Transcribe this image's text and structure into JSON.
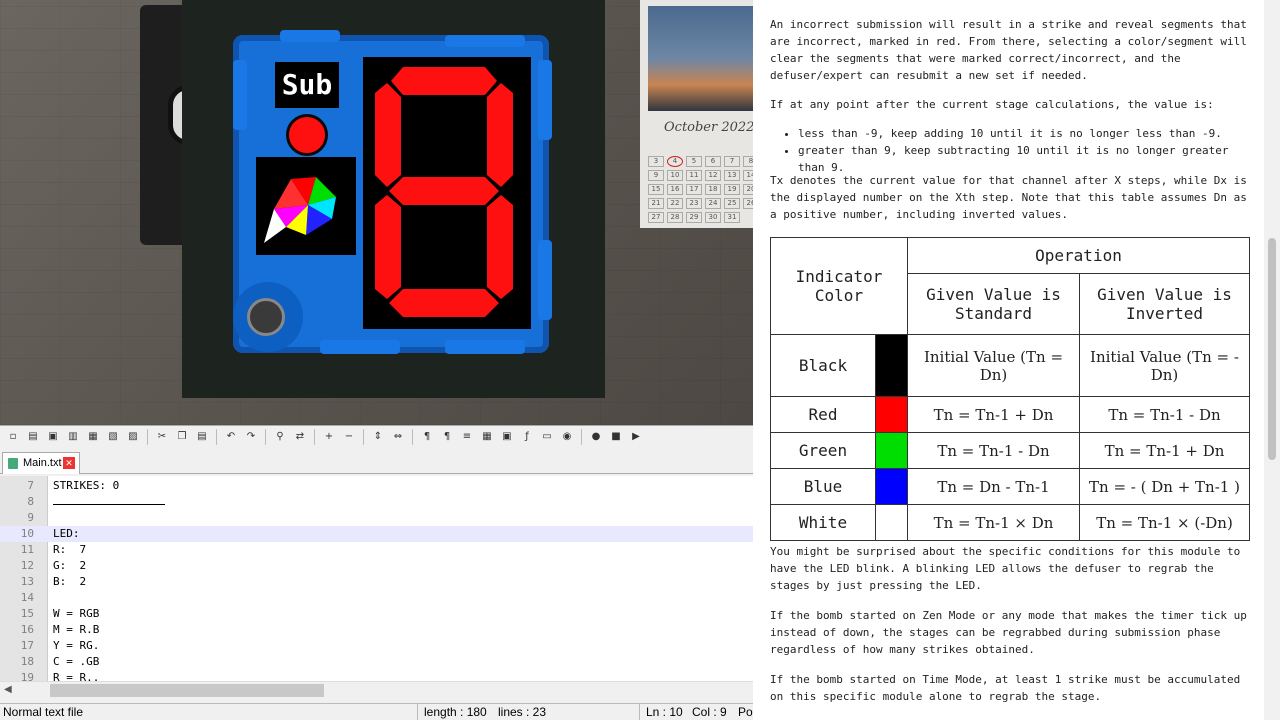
{
  "game": {
    "submit_label": "Sub",
    "led_color": "#ff1010",
    "display_color": "#ff1010",
    "calendar_month": "October 2022",
    "calendar_days": [
      "3",
      "4",
      "5",
      "6",
      "7",
      "8",
      "9",
      "10",
      "11",
      "12",
      "13",
      "14",
      "15",
      "16",
      "17",
      "18",
      "19",
      "20",
      "21",
      "22",
      "23",
      "24",
      "25",
      "26",
      "27",
      "28",
      "29",
      "30",
      "31"
    ]
  },
  "notepad": {
    "toolbar_icons": [
      "new-icon",
      "open-icon",
      "save-icon",
      "save-all-icon",
      "close-icon",
      "close-all-icon",
      "print-icon",
      "cut-icon",
      "copy-icon",
      "paste-icon",
      "undo-icon",
      "redo-icon",
      "find-icon",
      "replace-icon",
      "zoom-in-icon",
      "zoom-out-icon",
      "sync-v-icon",
      "sync-h-icon",
      "wrap-icon",
      "all-chars-icon",
      "indent-guide-icon",
      "udl-icon",
      "doc-map-icon",
      "function-list-icon",
      "folder-icon",
      "monitor-icon",
      "record-icon",
      "stop-icon",
      "play-icon"
    ],
    "tab_name": "Main.txt",
    "lines": [
      {
        "num": "7",
        "text": "STRIKES: 0"
      },
      {
        "num": "8",
        "text": ""
      },
      {
        "num": "9",
        "text": ""
      },
      {
        "num": "10",
        "text": "LED:"
      },
      {
        "num": "11",
        "text": "R:  7"
      },
      {
        "num": "12",
        "text": "G:  2"
      },
      {
        "num": "13",
        "text": "B:  2"
      },
      {
        "num": "14",
        "text": ""
      },
      {
        "num": "15",
        "text": "W = RGB"
      },
      {
        "num": "16",
        "text": "M = R.B"
      },
      {
        "num": "17",
        "text": "Y = RG."
      },
      {
        "num": "18",
        "text": "C = .GB"
      },
      {
        "num": "19",
        "text": "R = R.."
      }
    ],
    "status": {
      "type": "Normal text file",
      "length": "length : 180",
      "lines": "lines : 23",
      "ln": "Ln : 10",
      "col": "Col : 9",
      "pos": "Pos"
    }
  },
  "manual": {
    "para1": "An incorrect submission will result in a strike and reveal segments that are incorrect, marked in red. From there, selecting a color/segment will clear the segments that were marked correct/incorrect, and the defuser/expert can resubmit a new set if needed.",
    "para2": "If at any point after the current stage calculations, the value is:",
    "bullets": [
      "less than -9, keep adding 10 until it is no longer less than -9.",
      "greater than 9, keep subtracting 10 until it is no longer greater than 9."
    ],
    "para3": "Tx denotes the current value for that channel after X steps, while Dx is the displayed number on the Xth step. Note that this table assumes Dn as a positive number, including inverted values.",
    "table": {
      "col_indicator": "Indicator Color",
      "col_operation": "Operation",
      "col_standard": "Given Value is Standard",
      "col_inverted": "Given Value is Inverted",
      "rows": [
        {
          "color": "Black",
          "swatch": "#000000",
          "standard": "Initial Value (Tn = Dn)",
          "inverted": "Initial Value (Tn = -Dn)"
        },
        {
          "color": "Red",
          "swatch": "#ff0000",
          "standard": "Tn = Tn-1 + Dn",
          "inverted": "Tn = Tn-1 - Dn"
        },
        {
          "color": "Green",
          "swatch": "#00dd00",
          "standard": "Tn = Tn-1 - Dn",
          "inverted": "Tn = Tn-1 + Dn"
        },
        {
          "color": "Blue",
          "swatch": "#0000ff",
          "standard": "Tn = Dn - Tn-1",
          "inverted": "Tn = - ( Dn + Tn-1 )"
        },
        {
          "color": "White",
          "swatch": "#ffffff",
          "standard": "Tn = Tn-1 × Dn",
          "inverted": "Tn = Tn-1 × (-Dn)"
        }
      ]
    },
    "para4": "You might be surprised about the specific conditions for this module to have the LED blink. A blinking LED allows the defuser to regrab the stages by just pressing the LED.",
    "para5": "If the bomb started on Zen Mode or any mode that makes the timer tick up instead of down, the stages can be regrabbed during submission phase regardless of how many strikes obtained.",
    "para6": "If the bomb started on Time Mode, at least 1 strike must be accumulated on this specific module alone to regrab the stage."
  }
}
